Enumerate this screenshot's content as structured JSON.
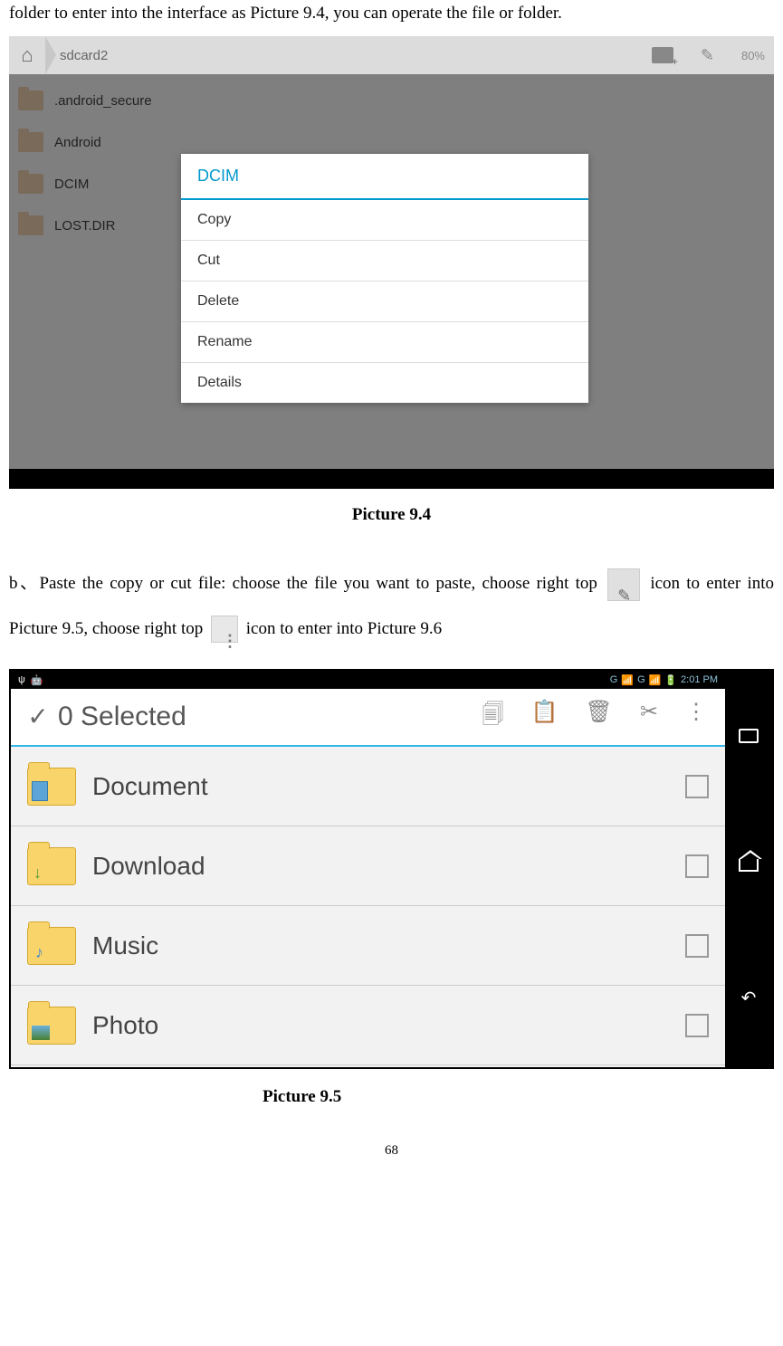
{
  "intro": "folder to enter into the interface as Picture 9.4, you can operate the file or folder.",
  "shot94": {
    "breadcrumb": "sdcard2",
    "topbarRight": "80%",
    "files": [
      ".android_secure",
      "Android",
      "DCIM",
      "LOST.DIR"
    ],
    "contextTitle": "DCIM",
    "contextItems": [
      "Copy",
      "Cut",
      "Delete",
      "Rename",
      "Details"
    ]
  },
  "caption94": "Picture 9.4",
  "paraB": {
    "prefix": "b、Paste the copy or cut file: choose the file you want to paste, choose right top",
    "mid1": "icon to enter into Picture 9.5, choose right top",
    "suffix": "icon to enter into Picture 9.6"
  },
  "shot95": {
    "statusTime": "2:01 PM",
    "statusSignal": "G",
    "selected": "0 Selected",
    "items": [
      "Document",
      "Download",
      "Music",
      "Photo"
    ]
  },
  "caption95": "Picture 9.5",
  "pageNum": "68"
}
